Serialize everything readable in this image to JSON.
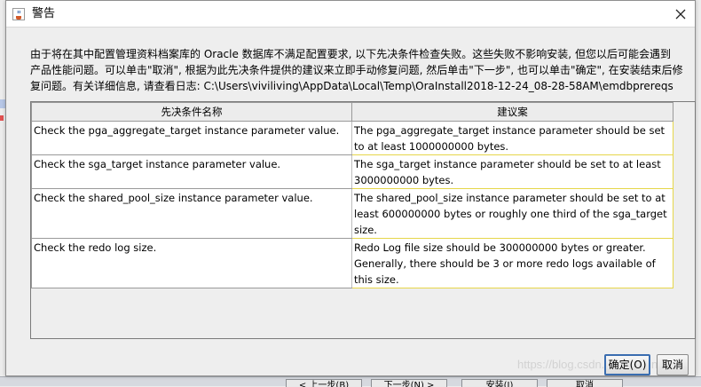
{
  "window": {
    "title": "警告",
    "close_icon": "close-icon",
    "title_icon": "java-cup-icon"
  },
  "message": {
    "line1": "由于将在其中配置管理资料档案库的 Oracle 数据库不满足配置要求, 以下先决条件检查失败。这些失败不影响安装, 但您以后可能会遇到",
    "line2": "产品性能问题。可以单击\"取消\", 根据为此先决条件提供的建议来立即手动修复问题, 然后单击\"下一步\", 也可以单击\"确定\", 在安装结束后修",
    "line3": "复问题。有关详细信息, 请查看日志: C:\\Users\\viviliving\\AppData\\Local\\Temp\\OraInstall2018-12-24_08-28-58AM\\emdbprereqs"
  },
  "table": {
    "headers": [
      "先决条件名称",
      "建议案"
    ],
    "rows": [
      {
        "name": "Check the pga_aggregate_target instance parameter value.",
        "suggestion": "The pga_aggregate_target instance parameter should be set to at least 1000000000 bytes."
      },
      {
        "name": "Check the sga_target instance parameter value.",
        "suggestion": "The sga_target instance parameter should be set to at least 3000000000 bytes."
      },
      {
        "name": "Check the shared_pool_size instance parameter value.",
        "suggestion": "The shared_pool_size instance parameter should be set to at least 600000000 bytes or roughly one third of the sga_target size."
      },
      {
        "name": "Check the redo log size.",
        "suggestion": "Redo Log file size should be 300000000 bytes or greater. Generally, there should be 3 or more redo logs available of this size."
      }
    ]
  },
  "buttons": {
    "ok": "确定(O)",
    "cancel": "取消"
  },
  "background": {
    "prev": "< 上一步(B)",
    "next": "下一步(N) >",
    "install": "安装(I)",
    "cancel": "取消"
  },
  "watermark": "https://blog.csdn.net/vivliving",
  "colors": {
    "accent_border": "#3a6db0",
    "suggestion_border": "#e6d64a"
  }
}
